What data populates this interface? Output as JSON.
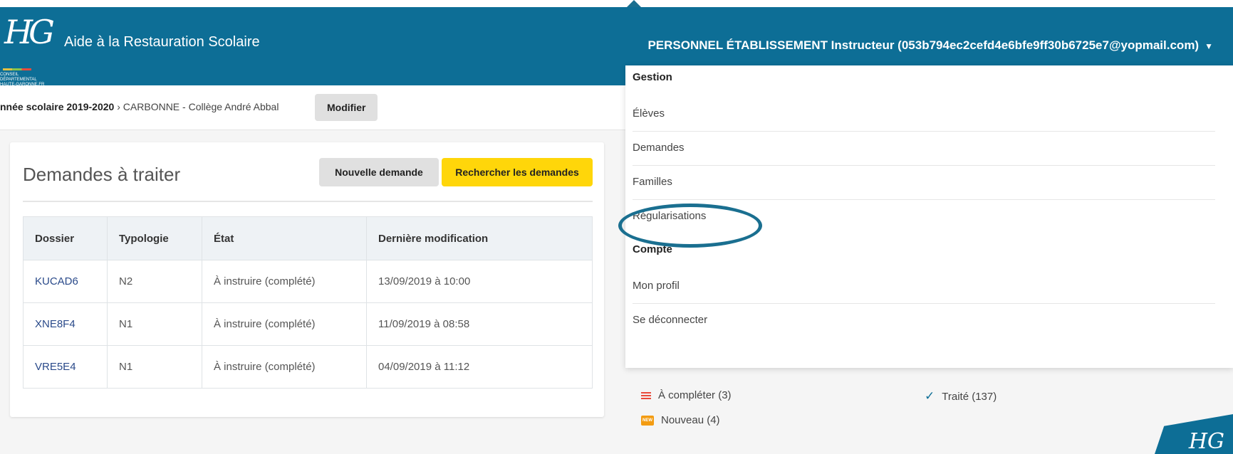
{
  "header": {
    "logo_letters": "HG",
    "logo_subtext": "CONSEIL DÉPARTEMENTAL HAUTE-GARONNE.FR",
    "app_title": "Aide à la Restauration Scolaire",
    "user_menu_label": "PERSONNEL ÉTABLISSEMENT Instructeur (053b794ec2cefd4e6bfe9ff30b6725e7@yopmail.com)",
    "brand_color": "#0d6e96"
  },
  "breadcrumb": {
    "year": "nnée scolaire 2019-2020",
    "separator": "›",
    "school": "CARBONNE - Collège André Abbal",
    "modify_label": "Modifier"
  },
  "card": {
    "title": "Demandes à traiter",
    "new_request_label": "Nouvelle demande",
    "search_label": "Rechercher les demandes",
    "columns": [
      "Dossier",
      "Typologie",
      "État",
      "Dernière modification"
    ],
    "rows": [
      {
        "dossier": "KUCAD6",
        "typologie": "N2",
        "etat": "À instruire (complété)",
        "modif": "13/09/2019 à 10:00"
      },
      {
        "dossier": "XNE8F4",
        "typologie": "N1",
        "etat": "À instruire (complété)",
        "modif": "11/09/2019 à 08:58"
      },
      {
        "dossier": "VRE5E4",
        "typologie": "N1",
        "etat": "À instruire (complété)",
        "modif": "04/09/2019 à 11:12"
      }
    ]
  },
  "dropdown": {
    "gestion_heading": "Gestion",
    "gestion_items": [
      "Élèves",
      "Demandes",
      "Familles",
      "Régularisations"
    ],
    "compte_heading": "Compte",
    "compte_items": [
      "Mon profil",
      "Se déconnecter"
    ]
  },
  "status": {
    "to_complete": "À compléter (3)",
    "treated": "Traité (137)",
    "new": "Nouveau (4)",
    "new_badge": "NEW"
  }
}
